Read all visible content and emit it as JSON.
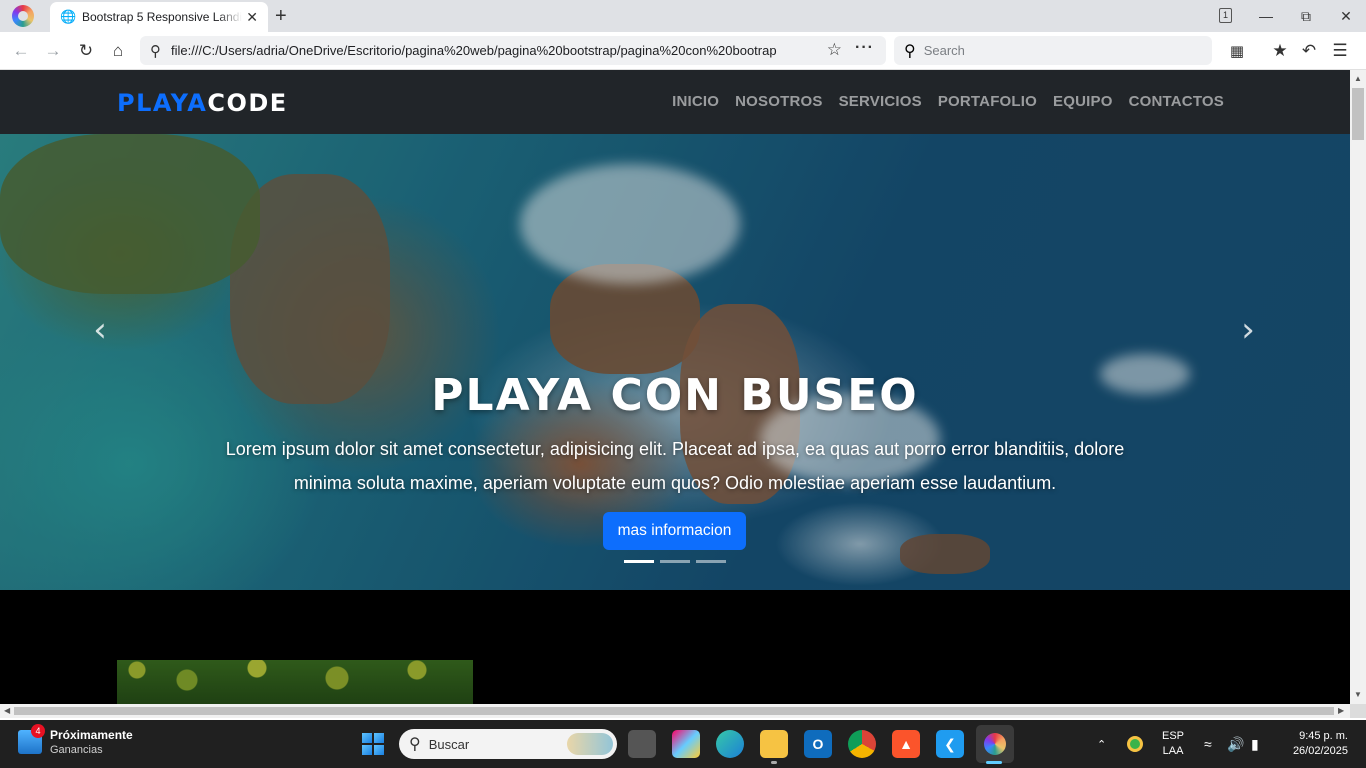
{
  "browser": {
    "tab_title": "Bootstrap 5 Responsive Landing Page",
    "tab_count": "1",
    "url": "file:///C:/Users/adria/OneDrive/Escritorio/pagina%20web/pagina%20bootstrap/pagina%20con%20bootrap",
    "search_placeholder": "Search"
  },
  "page": {
    "brand_part1": "PLAYA",
    "brand_part2": "CODE",
    "nav": [
      "INICIO",
      "NOSOTROS",
      "SERVICIOS",
      "PORTAFOLIO",
      "EQUIPO",
      "CONTACTOS"
    ],
    "hero": {
      "title": "PLAYA CON BUSEO",
      "text": "Lorem ipsum dolor sit amet consectetur, adipisicing elit. Placeat ad ipsa, ea quas aut porro error blanditiis, dolore minima soluta maxime, aperiam voluptate eum quos? Odio molestiae aperiam esse laudantium.",
      "button": "mas informacion",
      "slides": 3,
      "active_slide": 0
    }
  },
  "taskbar": {
    "widget_title": "Próximamente",
    "widget_subtitle": "Ganancias",
    "widget_badge": "4",
    "search_label": "Buscar",
    "lang_top": "ESP",
    "lang_bottom": "LAA",
    "time": "9:45 p. m.",
    "date": "26/02/2025"
  },
  "colors": {
    "brand_blue": "#0d6efd",
    "navbar_bg": "#212529"
  }
}
